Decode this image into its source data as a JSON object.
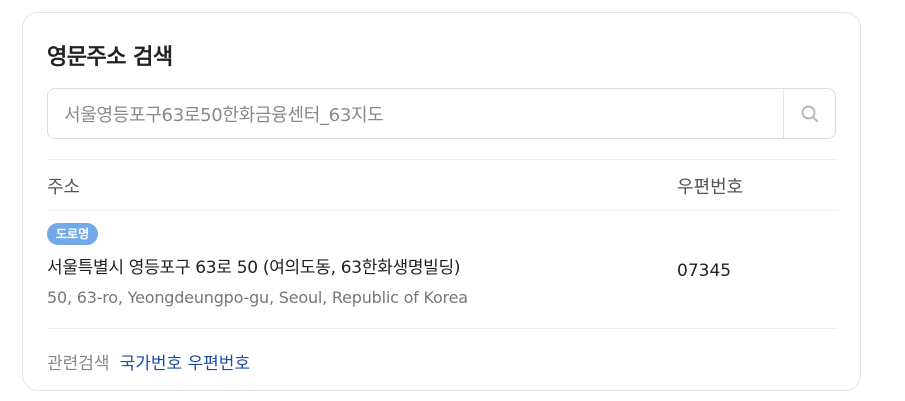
{
  "card": {
    "title": "영문주소 검색"
  },
  "search": {
    "value": "서울영등포구63로50한화금융센터_63지도",
    "placeholder": "",
    "icon": "search-icon"
  },
  "table": {
    "headers": {
      "address": "주소",
      "zipcode": "우편번호"
    },
    "rows": [
      {
        "badge": "도로명",
        "address_ko": "서울특별시 영등포구 63로 50 (여의도동, 63한화생명빌딩)",
        "address_en": "50, 63-ro, Yeongdeungpo-gu, Seoul, Republic of Korea",
        "zipcode": "07345"
      }
    ]
  },
  "related": {
    "label": "관련검색",
    "links": [
      "국가번호 우편번호"
    ]
  },
  "colors": {
    "badge": "#73a9e8",
    "link": "#1d4ea3",
    "border": "#e3e5e8"
  }
}
